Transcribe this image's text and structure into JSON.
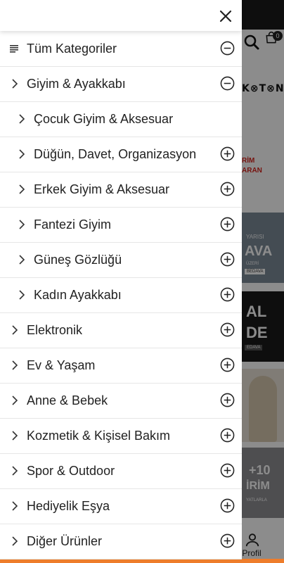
{
  "drawer": {
    "header_label": "Tüm Kategoriler",
    "items": [
      {
        "label": "Giyim & Ayakkabı",
        "level": 1,
        "state": "expanded"
      },
      {
        "label": "Çocuk Giyim & Aksesuar",
        "level": 2,
        "state": "none"
      },
      {
        "label": "Düğün, Davet, Organizasyon",
        "level": 2,
        "state": "collapsed"
      },
      {
        "label": "Erkek Giyim & Aksesuar",
        "level": 2,
        "state": "collapsed"
      },
      {
        "label": "Fantezi Giyim",
        "level": 2,
        "state": "collapsed"
      },
      {
        "label": "Güneş Gözlüğü",
        "level": 2,
        "state": "collapsed"
      },
      {
        "label": "Kadın Ayakkabı",
        "level": 2,
        "state": "collapsed"
      },
      {
        "label": "Elektronik",
        "level": 1,
        "state": "collapsed"
      },
      {
        "label": "Ev & Yaşam",
        "level": 1,
        "state": "collapsed"
      },
      {
        "label": "Anne & Bebek",
        "level": 1,
        "state": "collapsed"
      },
      {
        "label": "Kozmetik & Kişisel Bakım",
        "level": 1,
        "state": "collapsed"
      },
      {
        "label": "Spor & Outdoor",
        "level": 1,
        "state": "collapsed"
      },
      {
        "label": "Hediyelik Eşya",
        "level": 1,
        "state": "collapsed"
      },
      {
        "label": "Diğer Ürünler",
        "level": 1,
        "state": "collapsed"
      }
    ]
  },
  "background": {
    "cart_count": "0",
    "logo_text": "K⊗T⊗N",
    "promo_line1": "RİM",
    "promo_line2": "ARAN",
    "banner1_line1": "YARISI",
    "banner1_line2": "AVA",
    "banner1_line3": "ÜZERİ",
    "banner1_line4": "BEDAVA",
    "banner2_line1": "AL",
    "banner2_line2": "DE",
    "banner2_line3": "EDAVA",
    "banner4_line1": "+10",
    "banner4_line2": "İRİM",
    "banner4_line3": "YATLARLA",
    "profile_label": "Profil"
  },
  "colors": {
    "accent_orange": "#ee7d2b",
    "text": "#222222",
    "divider": "#e6e6e6"
  }
}
